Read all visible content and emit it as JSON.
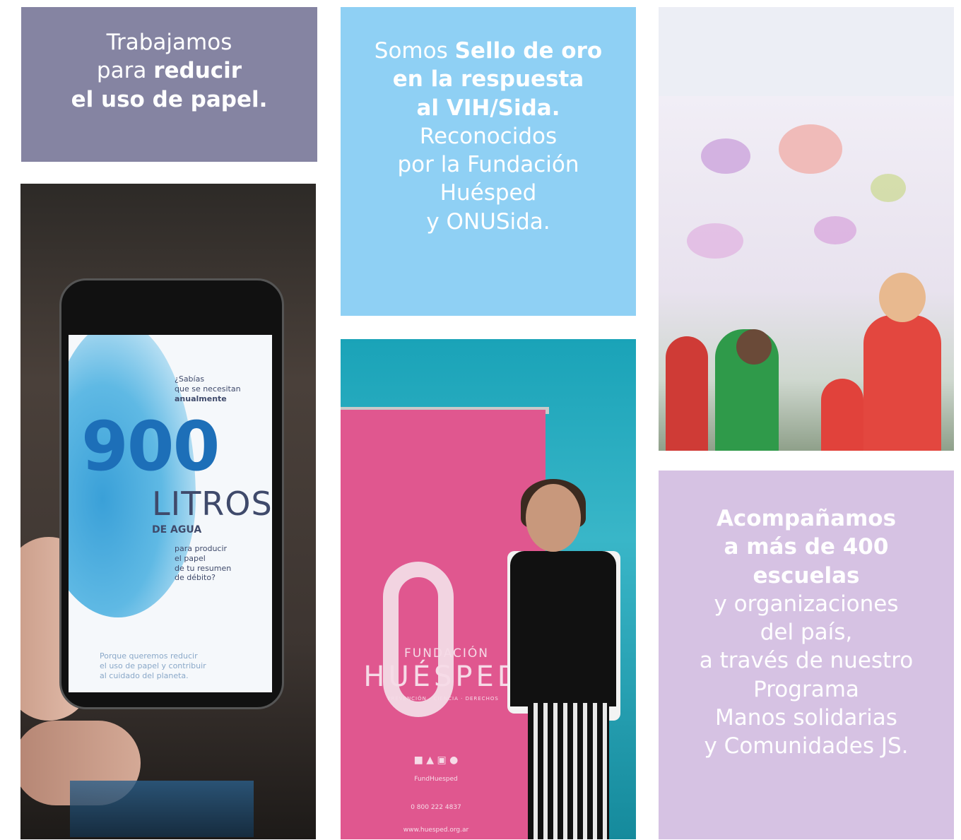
{
  "panel1": {
    "line1": "Trabajamos",
    "line2_a": "para ",
    "line2_b": "reducir",
    "line3": "el uso de papel."
  },
  "panel2": {
    "line1_a": "Somos ",
    "line1_b": "Sello de oro",
    "line2": "en la respuesta",
    "line3": "al VIH/Sida.",
    "line4": "Reconocidos",
    "line5": "por la Fundación",
    "line6": "Huésped",
    "line7": "y ONUSida."
  },
  "panel4": {
    "line1": "Acompañamos",
    "line2": "a más de 400",
    "line3": "escuelas",
    "line4": "y organizaciones",
    "line5": "del país,",
    "line6": "a través de nuestro",
    "line7": "Programa",
    "line8": "Manos solidarias",
    "line9": "y Comunidades JS."
  },
  "phone_screen": {
    "q1": "¿Sabías",
    "q2": "que se necesitan",
    "q3": "anualmente",
    "number": "900",
    "litros": "LITROS",
    "agua": "DE AGUA",
    "t1": "para producir",
    "t2": "el papel",
    "t3": "de tu resumen",
    "t4": "de débito?",
    "f1": "Porque queremos reducir",
    "f2": "el uso de papel y contribuir",
    "f3": "al cuidado del planeta."
  },
  "banner": {
    "fundacion": "FUNDACIÓN",
    "huesped": "HUÉSPED",
    "tagline": "PREVENCIÓN · CIENCIA · DERECHOS",
    "handle": "FundHuesped",
    "phone": "0 800 222 4837",
    "web": "www.huesped.org.ar"
  },
  "colors": {
    "panel1": "#8584a2",
    "panel2": "#8fd0f4",
    "panel3": "#eceef5",
    "panel4": "#d6c2e3",
    "banner": "#e0578f"
  }
}
